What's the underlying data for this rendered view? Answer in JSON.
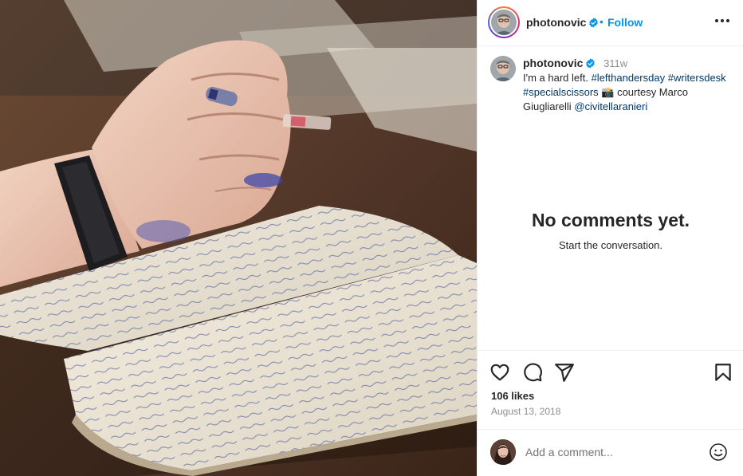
{
  "post": {
    "image_alt": "",
    "author": {
      "username": "photonovic",
      "verified": true
    },
    "header": {
      "separator": "•",
      "follow_label": "Follow"
    },
    "caption": {
      "username": "photonovic",
      "time_ago": "311w",
      "segments": [
        {
          "text": "I'm a hard left. ",
          "kind": "text"
        },
        {
          "text": "#lefthandersday",
          "kind": "tag"
        },
        {
          "text": " ",
          "kind": "text"
        },
        {
          "text": "#writersdesk",
          "kind": "tag"
        },
        {
          "text": " ",
          "kind": "text"
        },
        {
          "text": "#specialscissors",
          "kind": "tag"
        },
        {
          "text": " 📸 courtesy Marco Giugliarelli ",
          "kind": "text"
        },
        {
          "text": "@civitellaranieri",
          "kind": "tag"
        }
      ]
    },
    "comments_empty": {
      "title": "No comments yet.",
      "subtitle": "Start the conversation."
    },
    "actions": {
      "icons": [
        "heart-icon",
        "comment-icon",
        "share-icon",
        "bookmark-icon"
      ]
    },
    "likes_text": "106 likes",
    "date_text": "August 13, 2018",
    "add_comment": {
      "placeholder": "Add a comment...",
      "emoji_icon": "smiley-icon"
    }
  },
  "colors": {
    "link": "#0095f6",
    "hashtag": "#00376b",
    "text": "#262626",
    "muted": "#8e8e8e"
  }
}
